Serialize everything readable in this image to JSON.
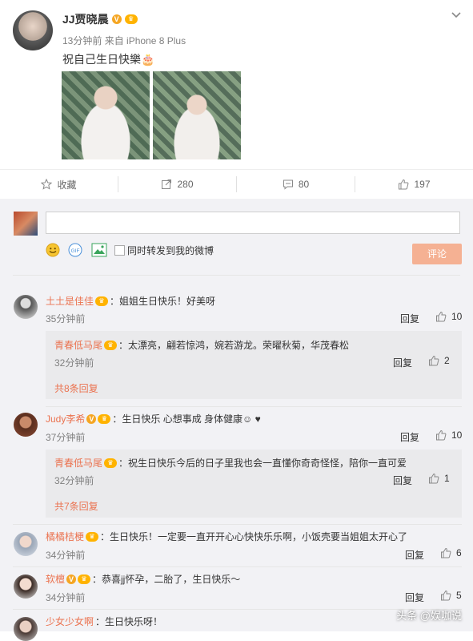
{
  "post": {
    "author": "JJ贾晓晨",
    "time": "13分钟前",
    "source": "来自 iPhone 8 Plus",
    "text": "祝自己生日快樂🎂",
    "badge_v": "V"
  },
  "actions": {
    "favorite": "收藏",
    "forward": "280",
    "comment": "80",
    "like": "197"
  },
  "composer": {
    "forward_also": "同时转发到我的微博",
    "submit": "评论"
  },
  "comments": [
    {
      "name": "土土是佳佳",
      "text": "：姐姐生日快乐！好美呀",
      "time": "35分钟前",
      "reply": "回复",
      "likes": "10"
    },
    {
      "name": "Judy李希",
      "text": "：生日快乐 心想事成 身体健康☺ ♥",
      "time": "37分钟前",
      "reply": "回复",
      "likes": "10"
    },
    {
      "name": "橘橘桔梗",
      "text": "：生日快乐！一定要一直开开心心快快乐乐啊，小饭壳要当姐姐太开心了",
      "time": "34分钟前",
      "reply": "回复",
      "likes": "6"
    },
    {
      "name": "软檀",
      "text": "：恭喜jj怀孕，二胎了，生日快乐～",
      "time": "34分钟前",
      "reply": "回复",
      "likes": "5"
    },
    {
      "name": "少女少女啊",
      "text": "：生日快乐呀！"
    }
  ],
  "subcomments": [
    {
      "name": "青春低马尾",
      "text": "：太漂亮，翩若惊鸿，婉若游龙。荣曜秋菊，华茂春松",
      "time": "32分钟前",
      "reply": "回复",
      "likes": "2",
      "more": "共8条回复"
    },
    {
      "name": "青春低马尾",
      "text": "：祝生日快乐今后的日子里我也会一直懂你奇奇怪怪，陪你一直可爱",
      "time": "32分钟前",
      "reply": "回复",
      "likes": "1",
      "more": "共7条回复"
    }
  ],
  "watermark": "头条 @娱咖说",
  "colors": {
    "accent": "#eb7350",
    "submit_bg": "#f5b193",
    "vip": "#ffb300",
    "verified": "#f5a623"
  }
}
